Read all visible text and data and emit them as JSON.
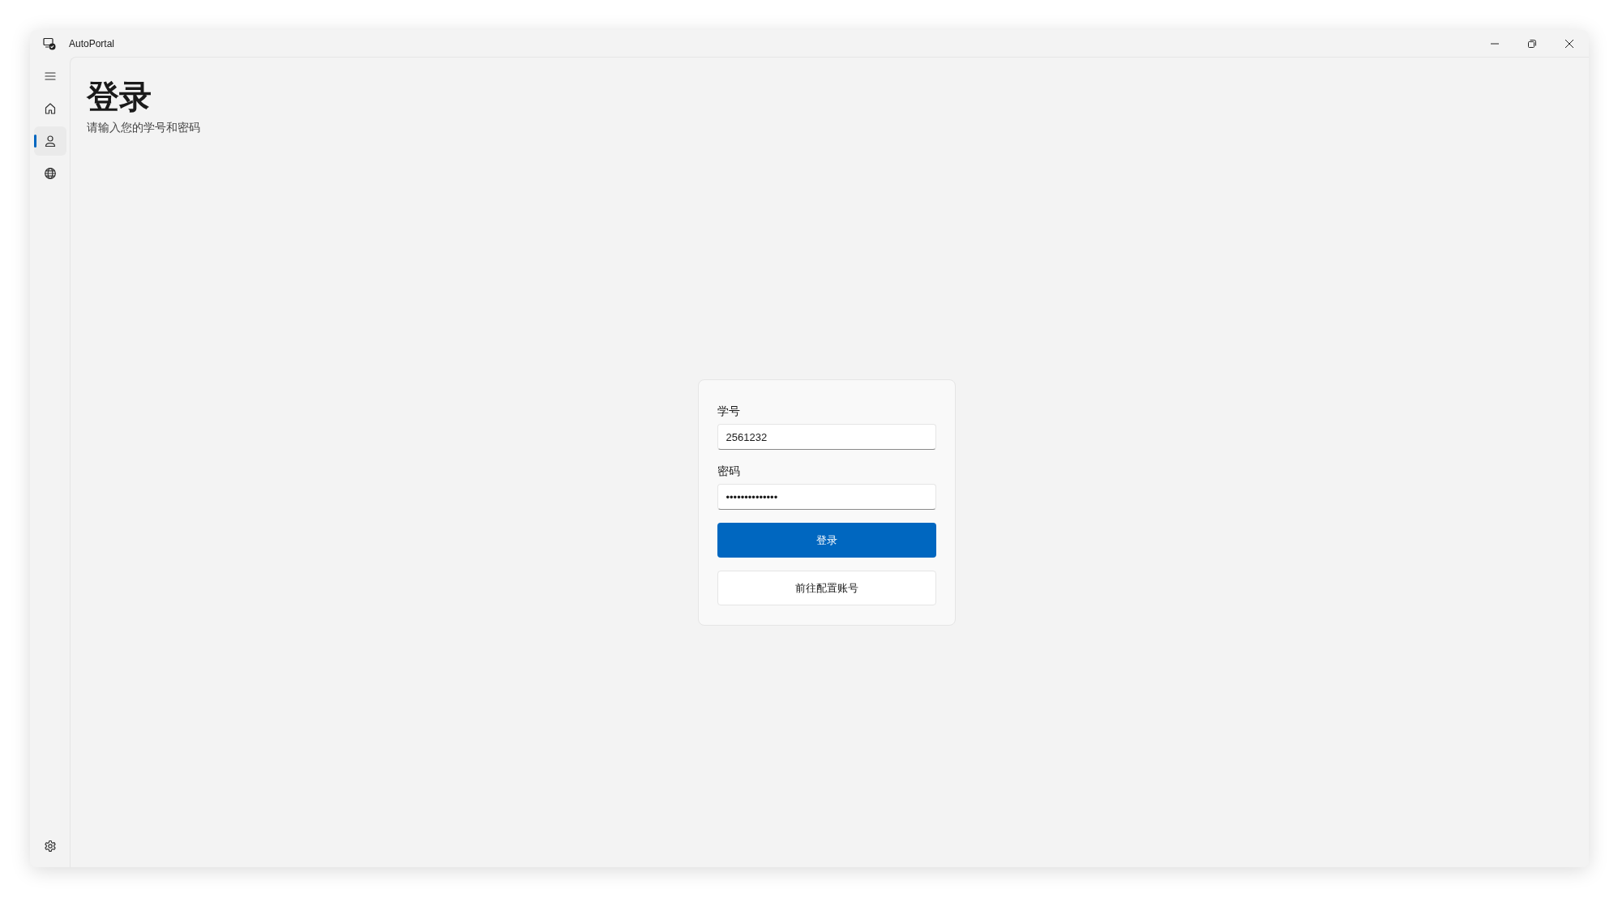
{
  "window": {
    "title": "AutoPortal"
  },
  "sidebar": {
    "items": [
      {
        "kind": "menu",
        "selected": false
      },
      {
        "kind": "home",
        "selected": false
      },
      {
        "kind": "person",
        "selected": true
      },
      {
        "kind": "globe",
        "selected": false
      }
    ],
    "footer_items": [
      {
        "kind": "settings",
        "selected": false
      }
    ]
  },
  "page": {
    "title": "登录",
    "subtitle": "请输入您的学号和密码"
  },
  "form": {
    "fields": [
      {
        "label": "学号",
        "value": "2561232"
      },
      {
        "label": "密码",
        "value": "••••••••••••••"
      }
    ],
    "buttons": [
      {
        "label": "登录",
        "kind": "primary"
      },
      {
        "label": "前往配置账号",
        "kind": "secondary"
      }
    ]
  }
}
